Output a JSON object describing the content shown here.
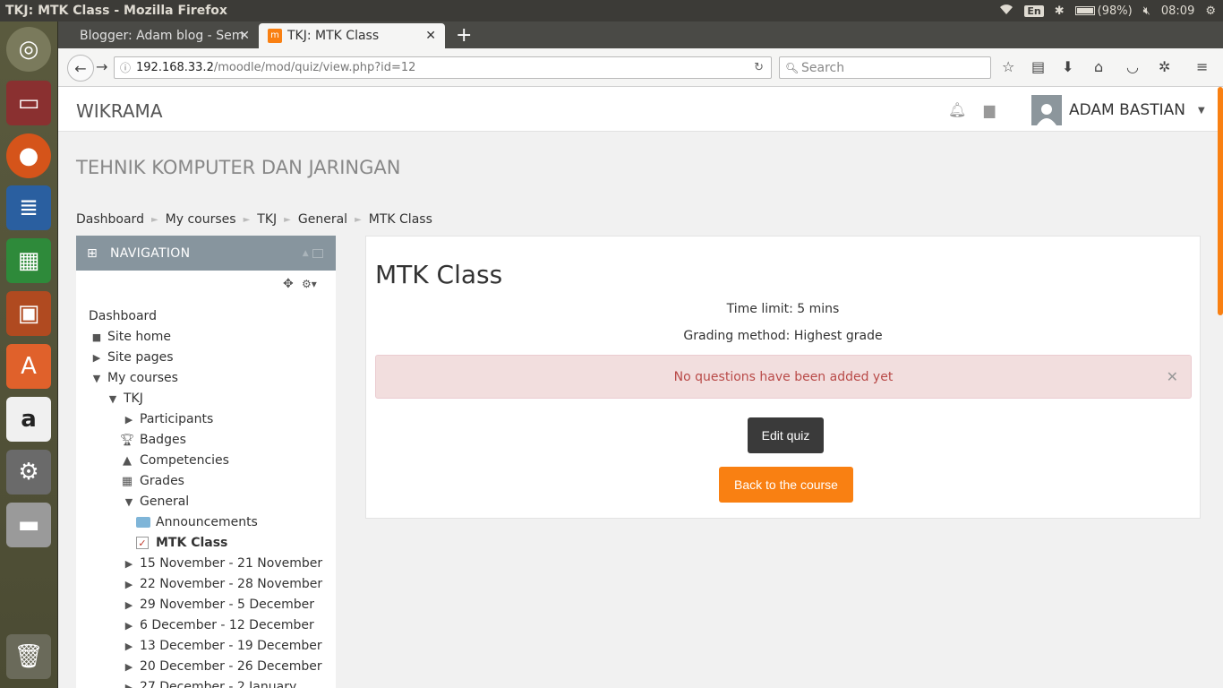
{
  "os": {
    "window_title": "TKJ: MTK Class - Mozilla Firefox",
    "keyboard": "En",
    "battery": "(98%)",
    "clock": "08:09"
  },
  "browser": {
    "tabs": [
      {
        "label": "Blogger: Adam blog - Sem"
      },
      {
        "label": "TKJ: MTK Class"
      }
    ],
    "url_host": "192.168.33.2",
    "url_path": "/moodle/mod/quiz/view.php?id=12",
    "search_placeholder": "Search"
  },
  "moodle": {
    "site_name": "WIKRAMA",
    "user_name": "ADAM BASTIAN",
    "course_title": "TEHNIK KOMPUTER DAN JARINGAN",
    "breadcrumb": [
      "Dashboard",
      "My courses",
      "TKJ",
      "General",
      "MTK Class"
    ],
    "navigation": {
      "title": "NAVIGATION",
      "items": [
        {
          "label": "Dashboard"
        },
        {
          "label": "Site home"
        },
        {
          "label": "Site pages"
        },
        {
          "label": "My courses"
        },
        {
          "label": "TKJ"
        },
        {
          "label": "Participants"
        },
        {
          "label": "Badges"
        },
        {
          "label": "Competencies"
        },
        {
          "label": "Grades"
        },
        {
          "label": "General"
        },
        {
          "label": "Announcements"
        },
        {
          "label": "MTK Class"
        },
        {
          "label": "15 November - 21 November"
        },
        {
          "label": "22 November - 28 November"
        },
        {
          "label": "29 November - 5 December"
        },
        {
          "label": "6 December - 12 December"
        },
        {
          "label": "13 December - 19 December"
        },
        {
          "label": "20 December - 26 December"
        },
        {
          "label": "27 December - 2 January"
        }
      ]
    },
    "quiz": {
      "title": "MTK Class",
      "time_limit": "Time limit: 5 mins",
      "grading_method": "Grading method: Highest grade",
      "alert": "No questions have been added yet",
      "edit_button": "Edit quiz",
      "back_button": "Back to the course"
    }
  }
}
